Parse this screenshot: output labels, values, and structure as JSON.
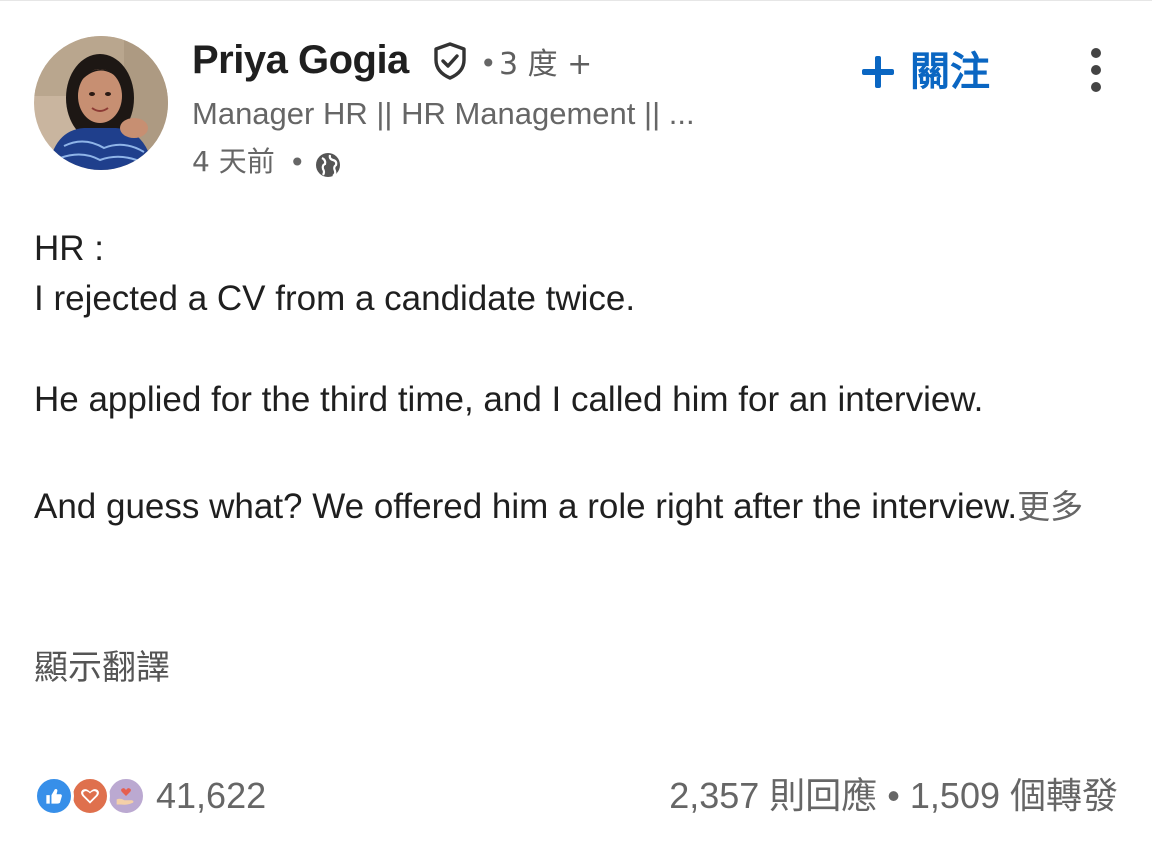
{
  "author": {
    "name": "Priya Gogia",
    "degree": "3 度 +",
    "headline": "Manager HR || HR Management || ...",
    "posted": "4 天前"
  },
  "actions": {
    "follow_label": "關注"
  },
  "post": {
    "line1": "HR :",
    "line2": "I rejected a CV from a candidate twice.",
    "line3": "He applied for the third time, and I called him for an interview.",
    "line4": "And guess what? We offered him a role right after the interview.",
    "see_more": "更多"
  },
  "translation": {
    "label": "顯示翻譯"
  },
  "social": {
    "reaction_count": "41,622",
    "comments": "2,357 則回應",
    "separator": "•",
    "reposts": "1,509 個轉發"
  },
  "icons": {
    "verified": "shield-check-icon",
    "globe": "globe-icon",
    "more": "more-vertical-icon",
    "reactions": [
      "like-icon",
      "love-icon",
      "support-icon"
    ]
  },
  "colors": {
    "accent": "#0a66c2",
    "like": "#378fe9",
    "love": "#df704d",
    "support": "#bba9d1"
  }
}
